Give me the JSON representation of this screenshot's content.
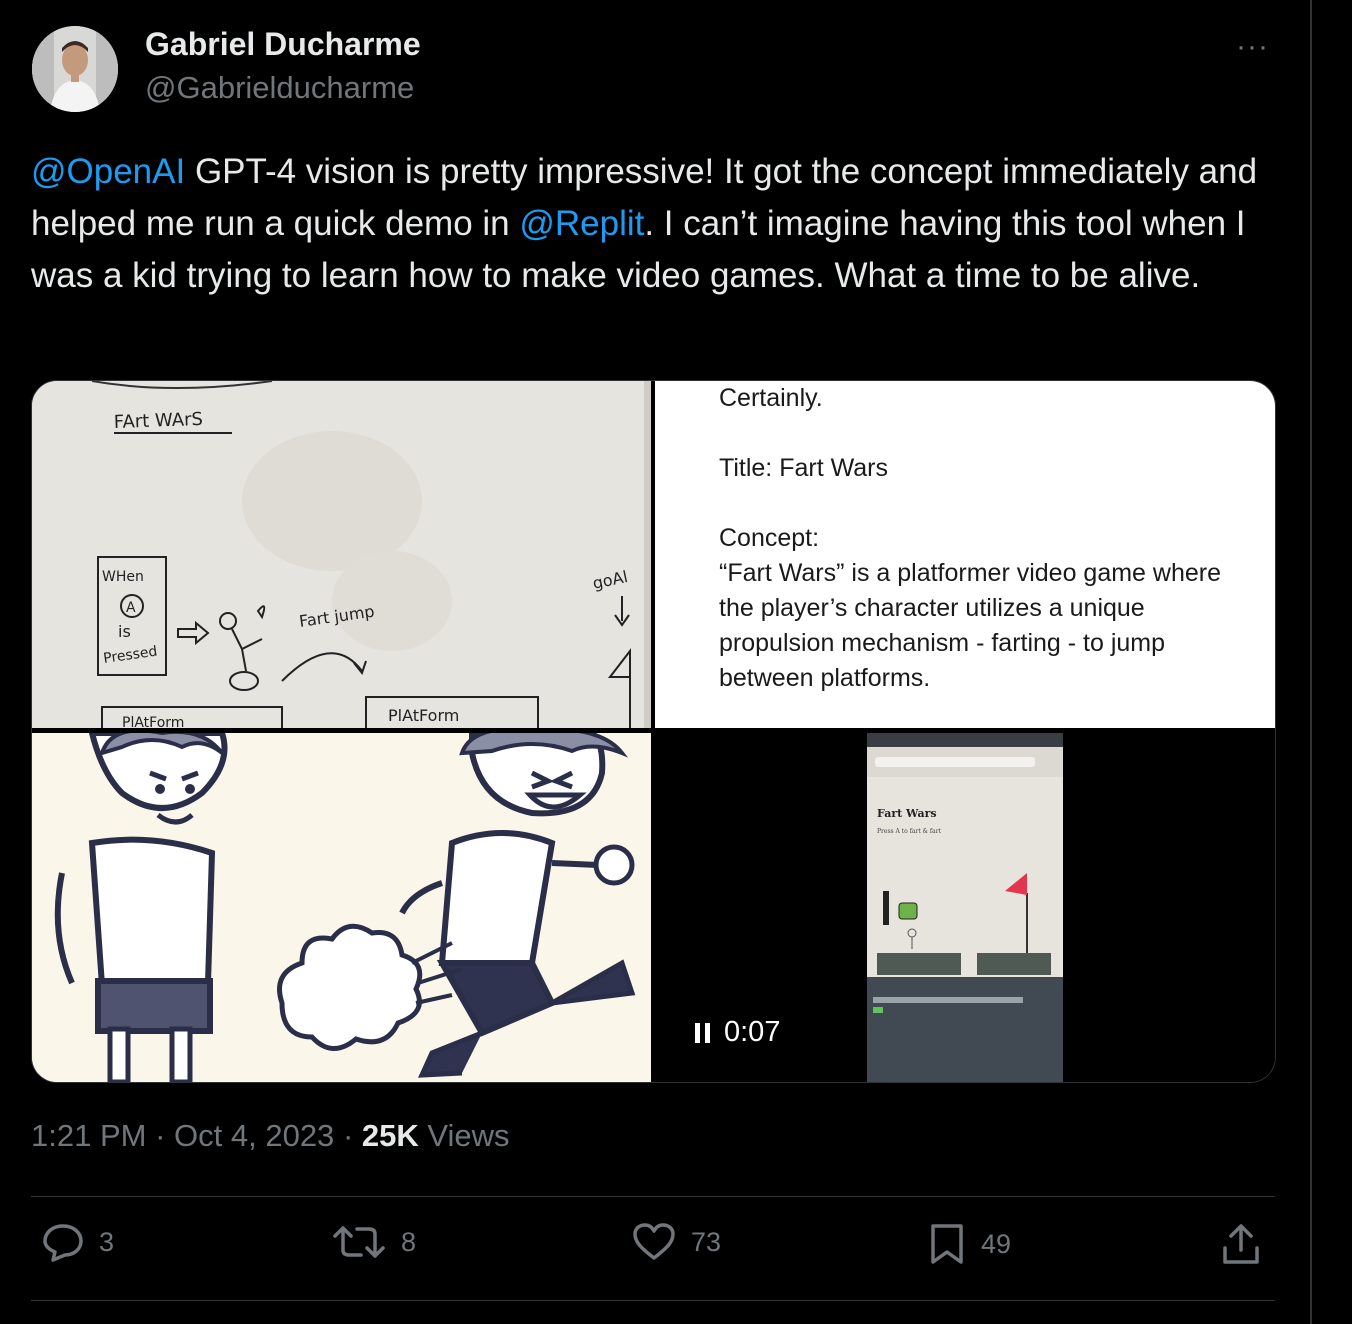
{
  "author": {
    "name": "Gabriel Ducharme",
    "handle": "@Gabrielducharme"
  },
  "more_label": "···",
  "tweet": {
    "mention1": "@OpenAI",
    "text1": " GPT-4 vision is pretty impressive! It got the concept immediately and helped me run a quick demo in ",
    "mention2": "@Replit",
    "text2": ". I can’t imagine having this tool when I was a kid trying to learn how to make video games. What a time to be alive."
  },
  "media": {
    "sketch": {
      "title": "FArt WArS",
      "when_box": [
        "WHen",
        "A",
        "is",
        "Pressed"
      ],
      "fart_jump": "Fart jump",
      "goal": "goAl",
      "platform": "PlAtForm",
      "platform_left": "PlAtForm"
    },
    "chat_text": {
      "line1": "Certainly.",
      "line2": "Title: Fart Wars",
      "line3": "Concept:",
      "line4": "“Fart Wars” is a platformer video game where the player’s character utilizes a unique propulsion mechanism - farting - to jump between platforms."
    },
    "video": {
      "time": "0:07",
      "game_title": "Fart Wars",
      "game_hint": "Press A to fart & fart"
    }
  },
  "meta": {
    "time": "1:21 PM",
    "sep": "·",
    "date": "Oct 4, 2023",
    "views_count": "25K",
    "views_label": "Views"
  },
  "actions": {
    "replies": "3",
    "retweets": "8",
    "likes": "73",
    "bookmarks": "49"
  },
  "colors": {
    "accent": "#1d9bf0",
    "muted": "#71767b",
    "text": "#e7e9ea",
    "bg": "#000000"
  }
}
